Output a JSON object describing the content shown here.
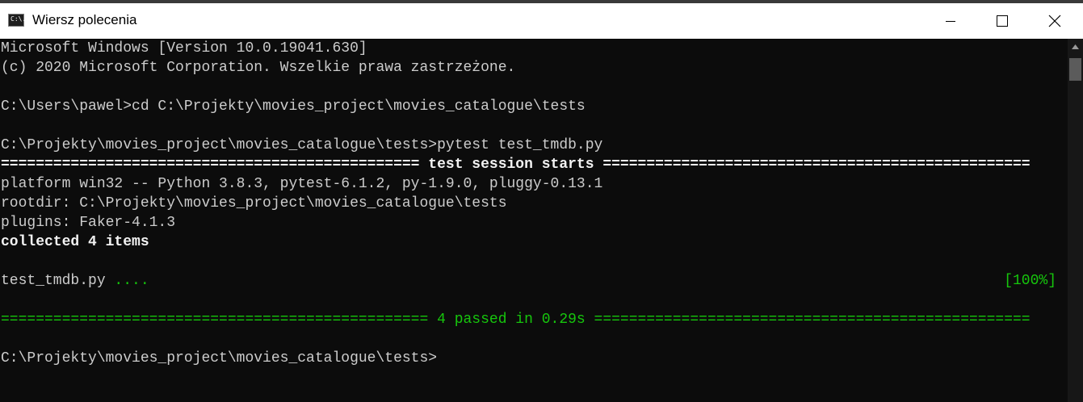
{
  "window": {
    "title": "Wiersz polecenia",
    "app_icon_text": "C:\\."
  },
  "lines": {
    "l1": "Microsoft Windows [Version 10.0.19041.630]",
    "l2": "(c) 2020 Microsoft Corporation. Wszelkie prawa zastrzeżone.",
    "l3": "C:\\Users\\pawel>cd C:\\Projekty\\movies_project\\movies_catalogue\\tests",
    "l4": "C:\\Projekty\\movies_project\\movies_catalogue\\tests>pytest test_tmdb.py",
    "l5": "================================================ test session starts =================================================",
    "l6": "platform win32 -- Python 3.8.3, pytest-6.1.2, py-1.9.0, pluggy-0.13.1",
    "l7": "rootdir: C:\\Projekty\\movies_project\\movies_catalogue\\tests",
    "l8": "plugins: Faker-4.1.3",
    "l9": "collected 4 items",
    "l10_file": "test_tmdb.py",
    "l10_dots": " ....",
    "l10_pct": "[100%]",
    "l11": "================================================= 4 passed in 0.29s ==================================================",
    "l12": "C:\\Projekty\\movies_project\\movies_catalogue\\tests>"
  },
  "colors": {
    "background": "#0c0c0c",
    "text": "#cccccc",
    "bold_text": "#f2f2f2",
    "pass_green": "#16c60c"
  },
  "icons": [
    "cmd-app-icon",
    "minimize-icon",
    "maximize-icon",
    "close-icon",
    "scroll-up-arrow-icon"
  ]
}
